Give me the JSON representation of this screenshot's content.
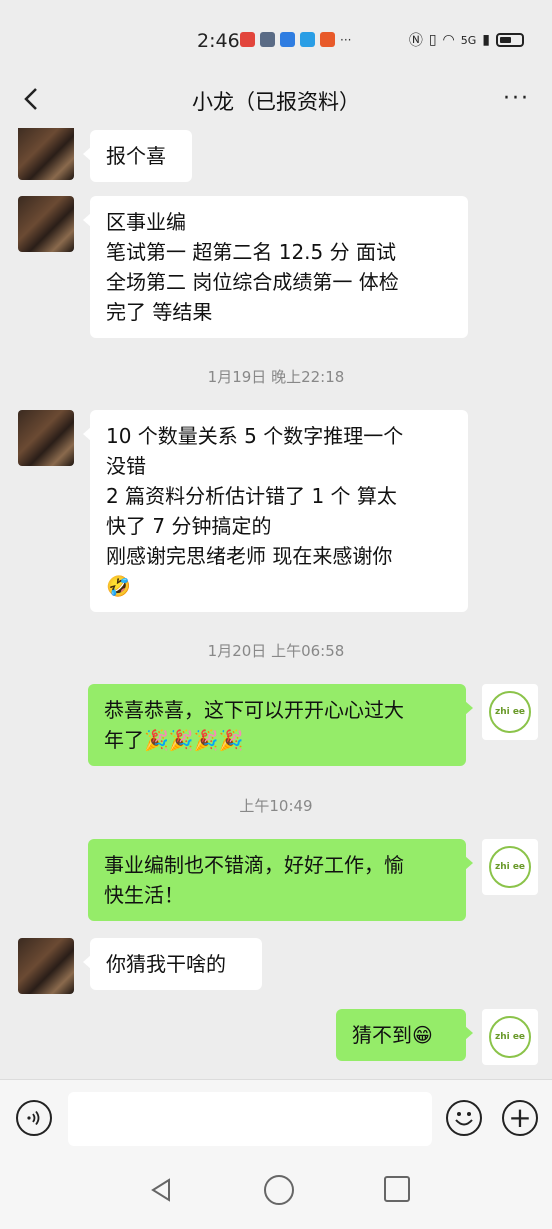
{
  "status_bar": {
    "time": "2:46",
    "network": "5G",
    "battery_level": 0.55
  },
  "header": {
    "title": "小龙（已报资料）",
    "more_label": "···"
  },
  "messages": [
    {
      "side": "in",
      "lines": [
        "报个喜"
      ]
    },
    {
      "side": "in",
      "lines": [
        "区事业编",
        "笔试第一  超第二名 12.5 分 面试",
        "全场第二 岗位综合成绩第一 体检",
        "完了 等结果"
      ]
    },
    {
      "side": "time",
      "text": "1月19日 晚上22:18"
    },
    {
      "side": "in",
      "lines": [
        "10 个数量关系 5 个数字推理一个",
        "没错",
        "2 篇资料分析估计错了 1 个 算太",
        "快了 7 分钟搞定的",
        "刚感谢完思绪老师 现在来感谢你",
        "🤣"
      ]
    },
    {
      "side": "time",
      "text": "1月20日 上午06:58"
    },
    {
      "side": "out",
      "lines": [
        "恭喜恭喜，这下可以开开心心过大",
        "年了🎉🎉🎉🎉"
      ]
    },
    {
      "side": "time",
      "text": "上午10:49"
    },
    {
      "side": "out",
      "lines": [
        "事业编制也不错滴，好好工作，愉",
        "快生活！"
      ]
    },
    {
      "side": "in",
      "lines": [
        "你猜我干啥的"
      ]
    },
    {
      "side": "out",
      "lines": [
        "猜不到😁"
      ]
    }
  ],
  "avatar_right_text": "zhi ee",
  "input": {
    "placeholder": "",
    "voice_icon": "voice-icon",
    "emoji_icon": "emoji-icon",
    "plus_icon": "plus-icon"
  },
  "colors": {
    "background": "#ededed",
    "bubble_in": "#ffffff",
    "bubble_out": "#95ec69"
  }
}
